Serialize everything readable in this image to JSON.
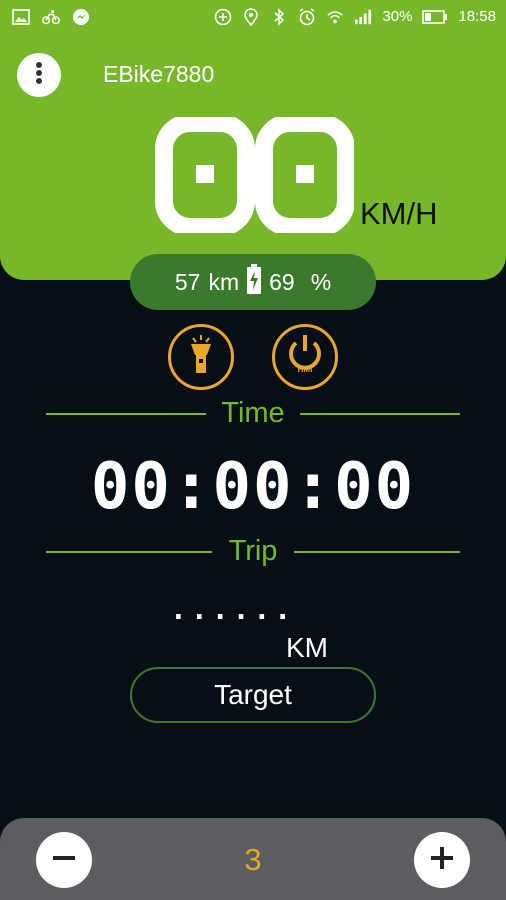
{
  "status_bar": {
    "battery_percent_text": "30%",
    "time": "18:58",
    "left_icons": [
      "image-icon",
      "bike-icon",
      "messenger-icon"
    ],
    "right_icons": [
      "plus-circle-icon",
      "location-icon",
      "bluetooth-icon",
      "alarm-icon",
      "wifi-icon",
      "signal-icon",
      "battery-icon"
    ]
  },
  "header": {
    "device_name": "EBike7880",
    "menu_icon": "more-vertical-icon"
  },
  "speed": {
    "value": "00",
    "unit": "KM/H"
  },
  "info_pill": {
    "range_value": "57",
    "range_unit": "km",
    "battery_value": "69",
    "battery_unit": "%"
  },
  "controls": {
    "light_icon": "flashlight-icon",
    "power_icon": "power-hmi-icon",
    "power_badge": "HMI"
  },
  "time_section": {
    "label": "Time",
    "value": "00:00:00"
  },
  "trip_section": {
    "label": "Trip",
    "value": "······",
    "unit": "KM",
    "target_label": "Target"
  },
  "bottom": {
    "minus_icon": "minus-icon",
    "plus_icon": "plus-icon",
    "level": "3"
  },
  "colors": {
    "green": "#76b82a",
    "dark_green": "#3b7a2c",
    "amber": "#e8a62a",
    "background": "#070f16"
  }
}
